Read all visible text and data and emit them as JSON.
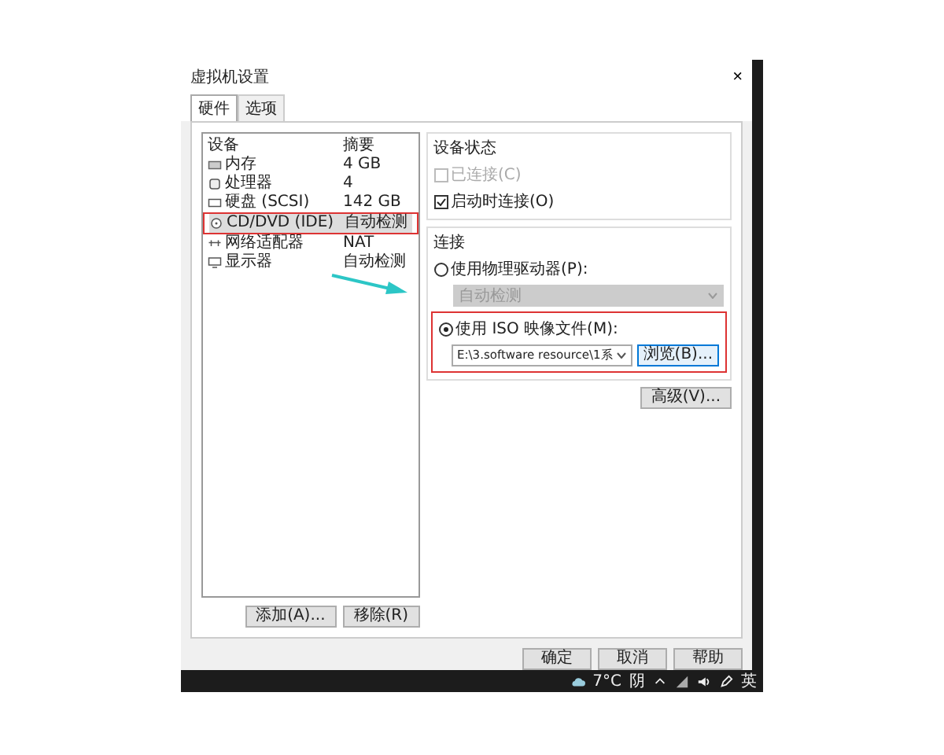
{
  "window": {
    "title": "虚拟机设置",
    "close": "×"
  },
  "tabs": [
    {
      "label": "硬件",
      "selected": true
    },
    {
      "label": "选项",
      "selected": false
    }
  ],
  "device_list": {
    "columns": [
      "设备",
      "摘要"
    ],
    "rows": [
      {
        "kind": "memory",
        "device": "内存",
        "summary": "4 GB",
        "selected": false
      },
      {
        "kind": "cpu",
        "device": "处理器",
        "summary": "4",
        "selected": false
      },
      {
        "kind": "disk",
        "device": "硬盘 (SCSI)",
        "summary": "142 GB",
        "selected": false
      },
      {
        "kind": "cd",
        "device": "CD/DVD (IDE)",
        "summary": "自动检测",
        "selected": true
      },
      {
        "kind": "network",
        "device": "网络适配器",
        "summary": "NAT",
        "selected": false
      },
      {
        "kind": "display",
        "device": "显示器",
        "summary": "自动检测",
        "selected": false
      }
    ]
  },
  "list_buttons": [
    "添加(A)...",
    "移除(R)"
  ],
  "device_status": {
    "title": "设备状态",
    "options": [
      {
        "label": "已连接(C)",
        "checked": false,
        "disabled": true
      },
      {
        "label": "启动时连接(O)",
        "checked": true,
        "disabled": false
      }
    ]
  },
  "connection": {
    "title": "连接",
    "physical": {
      "label": "使用物理驱动器(P):",
      "selected": false
    },
    "drive_select": {
      "value": "自动检测",
      "disabled": true
    },
    "iso": {
      "label": "使用 ISO 映像文件(M):",
      "selected": true
    },
    "iso_path": "E:\\3.software resource\\1系",
    "browse": "浏览(B)..."
  },
  "advanced": "高级(V)...",
  "dialog_buttons": [
    "确定",
    "取消",
    "帮助"
  ],
  "taskbar": {
    "temperature": "7°C",
    "weather": "阴",
    "language": "英"
  }
}
